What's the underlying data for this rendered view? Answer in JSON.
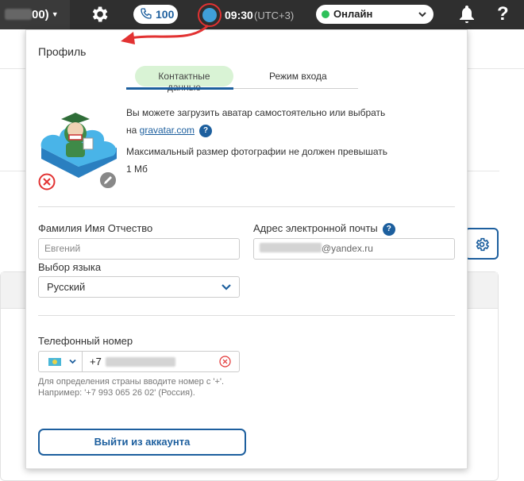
{
  "topbar": {
    "balance_suffix": "00)",
    "calls_count": "100",
    "time": "09:30",
    "timezone": "(UTC+3)",
    "status": "Онлайн",
    "help": "?",
    "status_color": "#2ec05a"
  },
  "profile": {
    "title": "Профиль",
    "tabs": [
      {
        "label": "Контактные данные",
        "active": true
      },
      {
        "label": "Режим входа",
        "active": false
      }
    ],
    "avatar_info": {
      "line1": "Вы можете загрузить аватар самостоятельно или выбрать",
      "line2_prefix": "на",
      "gravatar_link": "gravatar.com",
      "size_line1": "Максимальный размер фотографии не должен превышать",
      "size_line2": "1 Мб",
      "help": "?"
    },
    "fields": {
      "name_label": "Фамилия Имя Отчество",
      "name_placeholder": "Евгений",
      "email_label": "Адрес электронной почты",
      "email_domain": "@yandex.ru",
      "language_label": "Выбор языка",
      "language_value": "Русский",
      "phone_label": "Телефонный номер",
      "phone_code": "+7",
      "phone_hint": "Для определения страны вводите номер с '+'. Например: '+7 993 065 26 02' (Россия)."
    },
    "logout_label": "Выйти из аккаунта"
  },
  "colors": {
    "accent": "#1d5f9e",
    "active_tab_bg": "#d9f3d5",
    "annotation": "#e23232"
  }
}
